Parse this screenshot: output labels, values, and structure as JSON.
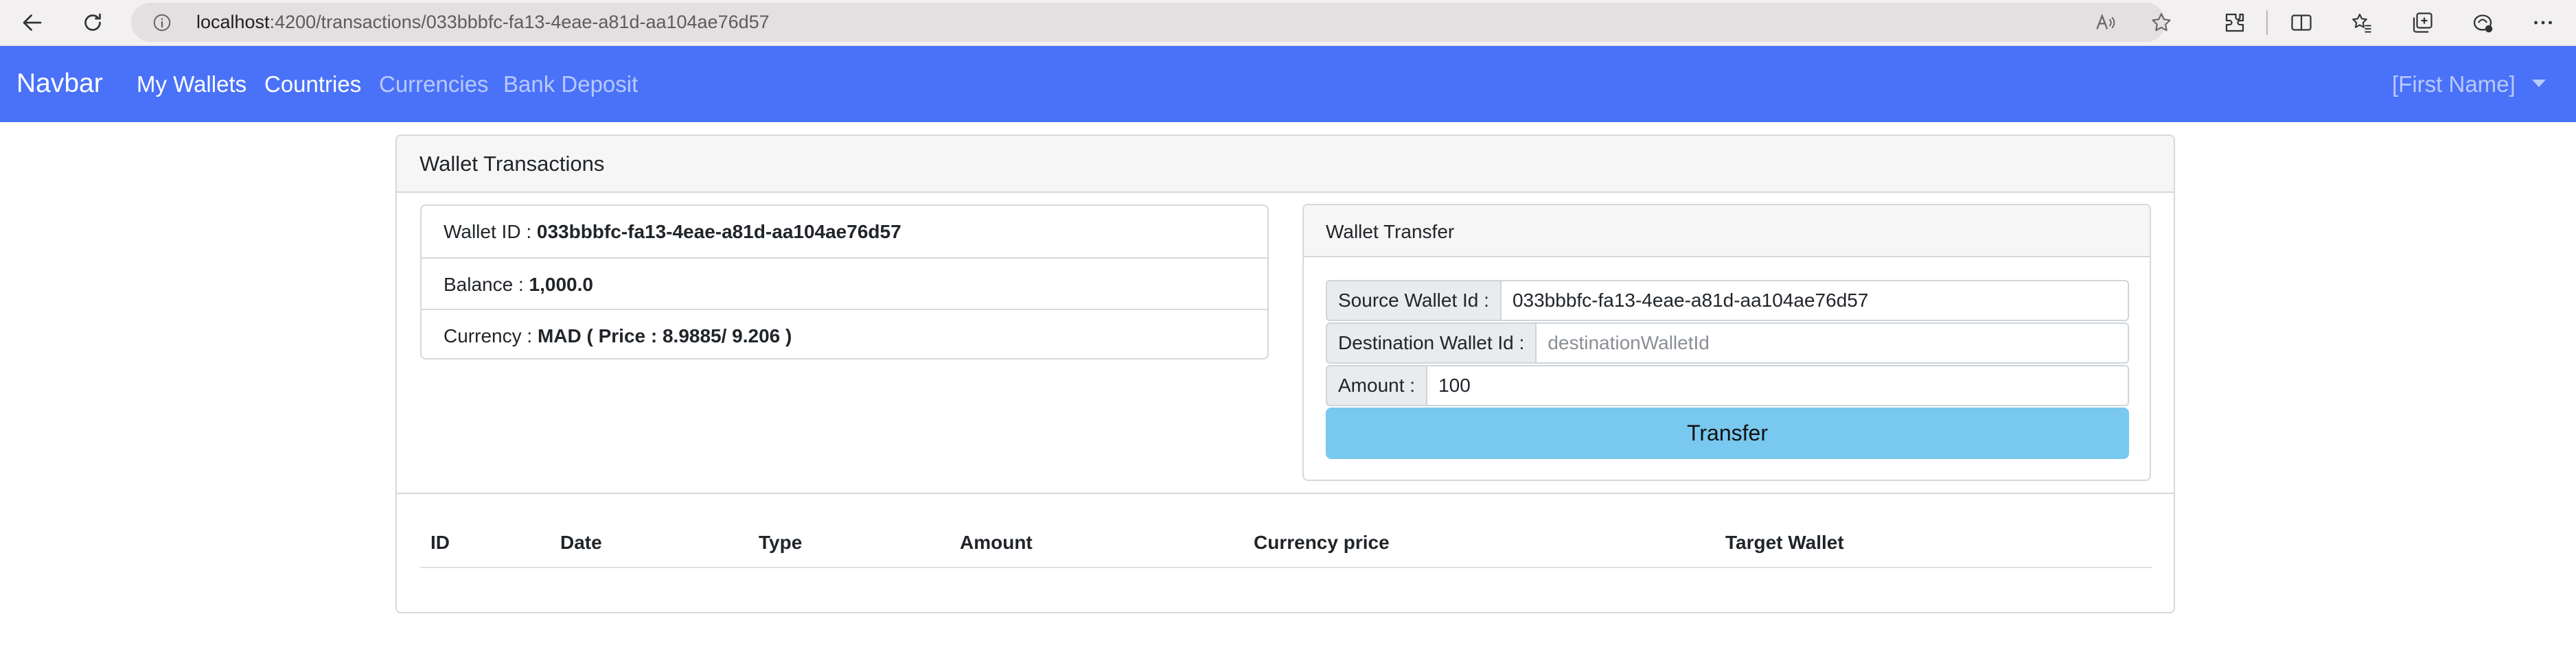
{
  "browser": {
    "url_host": "localhost",
    "url_path": ":4200/transactions/033bbbfc-fa13-4eae-a81d-aa104ae76d57"
  },
  "navbar": {
    "brand": "Navbar",
    "links": [
      {
        "label": "My Wallets",
        "state": "active"
      },
      {
        "label": "Countries",
        "state": "active"
      },
      {
        "label": "Currencies",
        "state": "muted"
      },
      {
        "label": "Bank Deposit",
        "state": "muted"
      }
    ],
    "user_label": "[First Name]",
    "colors": {
      "background": "#4a72f8",
      "active_text": "#ffffff",
      "muted_text": "#b9c9fd"
    }
  },
  "card": {
    "title": "Wallet Transactions"
  },
  "wallet_info": {
    "id_label": "Wallet ID : ",
    "id_value": "033bbbfc-fa13-4eae-a81d-aa104ae76d57",
    "balance_label": "Balance : ",
    "balance_value": "1,000.0",
    "currency_label": "Currency : ",
    "currency_value": "MAD ( Price : 8.9885/ 9.206 )"
  },
  "transfer": {
    "title": "Wallet Transfer",
    "source_label": "Source Wallet Id :",
    "source_value": "033bbbfc-fa13-4eae-a81d-aa104ae76d57",
    "destination_label": "Destination Wallet Id :",
    "destination_value": "",
    "destination_placeholder": "destinationWalletId",
    "amount_label": "Amount :",
    "amount_value": "100",
    "button_label": "Transfer",
    "button_color": "#78c8ef"
  },
  "table": {
    "headers": [
      "ID",
      "Date",
      "Type",
      "Amount",
      "Currency price",
      "Target Wallet"
    ],
    "rows": []
  }
}
